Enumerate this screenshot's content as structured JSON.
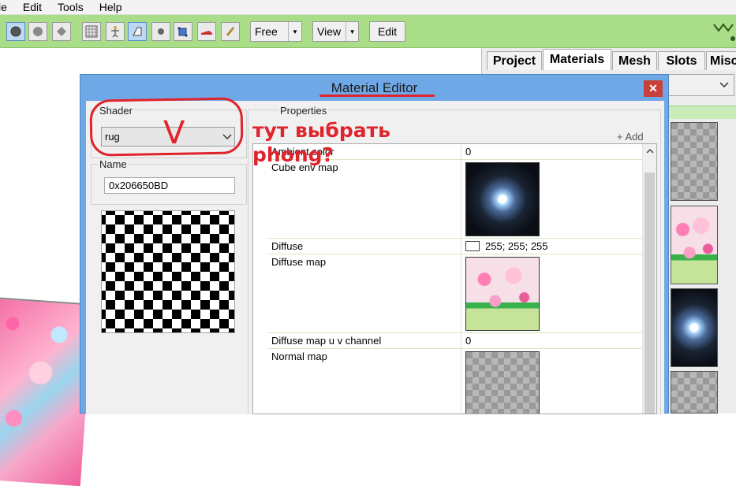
{
  "menu": [
    "le",
    "Edit",
    "Tools",
    "Help"
  ],
  "toolbar": {
    "free_label": "Free",
    "view_label": "View",
    "edit_label": "Edit"
  },
  "panel_tabs": [
    "Project",
    "Materials",
    "Mesh",
    "Slots",
    "Misc"
  ],
  "dialog": {
    "title": "Material Editor",
    "close_glyph": "✕",
    "shader_label": "Shader",
    "shader_value": "rug",
    "name_label": "Name",
    "name_value": "0x206650BD",
    "properties_label": "Properties",
    "add_label": "+ Add",
    "rows": [
      {
        "name": "Ambient color",
        "value": "0"
      },
      {
        "name": "Cube env map",
        "value": ""
      },
      {
        "name": "Diffuse",
        "value": "255; 255; 255"
      },
      {
        "name": "Diffuse map",
        "value": ""
      },
      {
        "name": "Diffuse map u v channel",
        "value": "0"
      },
      {
        "name": "Normal map",
        "value": ""
      }
    ]
  },
  "annotation": {
    "mark": "V",
    "line1": "тут выбрать",
    "line2": "phong?",
    "color": "#e0242c"
  }
}
